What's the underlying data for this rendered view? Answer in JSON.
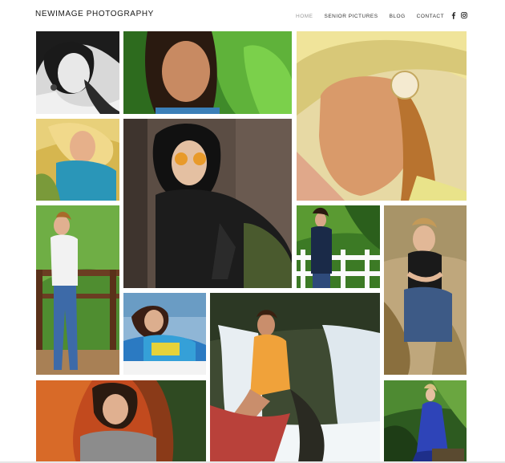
{
  "site": {
    "logo": "NEWIMAGE PHOTOGRAPHY"
  },
  "nav": {
    "home": "HOME",
    "senior_pictures": "SENIOR PICTURES",
    "blog": "BLOG",
    "contact": "CONTACT"
  },
  "social": {
    "facebook": "facebook-icon",
    "instagram": "instagram-icon"
  },
  "colors": {
    "nav_active": "#9a9a9a",
    "nav_default": "#333333",
    "logo": "#1a1a1a"
  }
}
